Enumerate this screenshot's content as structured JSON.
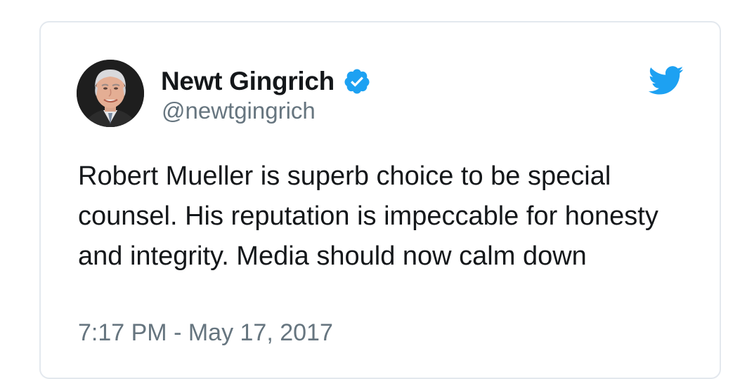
{
  "tweet": {
    "author": {
      "display_name": "Newt Gingrich",
      "handle": "@newtgingrich",
      "verified": true,
      "avatar_icon": "profile-photo"
    },
    "text": "Robert Mueller is superb choice to be special counsel. His reputation is impeccable for honesty and integrity. Media should now calm down",
    "timestamp": "7:17 PM - May 17, 2017"
  },
  "icons": {
    "verified": "verified-badge-icon",
    "brand": "twitter-bird-icon"
  },
  "colors": {
    "brand": "#1da1f2",
    "text_primary": "#14171a",
    "text_secondary": "#66757f",
    "card_border": "#e3e8ee"
  }
}
